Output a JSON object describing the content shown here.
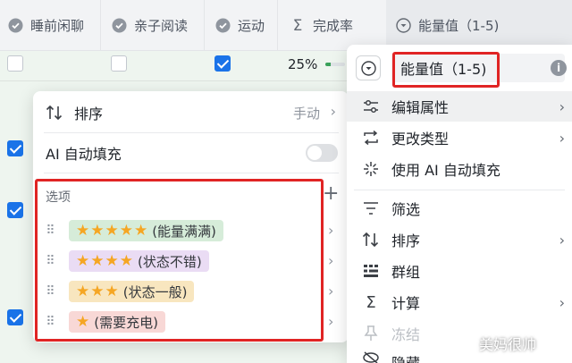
{
  "header": {
    "columns": [
      {
        "label": "睡前闲聊",
        "icon": "checkbox-field-icon"
      },
      {
        "label": "亲子阅读",
        "icon": "checkbox-field-icon"
      },
      {
        "label": "运动",
        "icon": "checkbox-field-icon"
      },
      {
        "label": "完成率",
        "icon": "sigma-formula-icon"
      },
      {
        "label": "能量值（1-5)",
        "icon": "single-select-field-icon"
      }
    ]
  },
  "rows": [
    {
      "col1": false,
      "col2": false,
      "col3": true,
      "progress_label": "25%",
      "progress": 0.25
    }
  ],
  "left_checks": [
    true,
    true,
    true
  ],
  "popup": {
    "sort_label": "排序",
    "sort_value": "手动",
    "ai_fill_label": "AI 自动填充",
    "ai_fill_on": false,
    "options_title": "选项",
    "add_symbol": "+",
    "options": [
      {
        "stars": "★★★★★",
        "text": "(能量满满)",
        "color": "#d6ecd9"
      },
      {
        "stars": "★★★★",
        "text": "(状态不错)",
        "color": "#eadcf4"
      },
      {
        "stars": "★★★",
        "text": "(状态一般)",
        "color": "#f8e6bf"
      },
      {
        "stars": "★",
        "text": "(需要充电)",
        "color": "#f8d8d6"
      }
    ]
  },
  "menu": {
    "field_name": "能量值（1-5)",
    "info_symbol": "i",
    "items": [
      {
        "label": "编辑属性",
        "icon": "sliders-icon",
        "chevron": true
      },
      {
        "label": "更改类型",
        "icon": "swap-icon",
        "chevron": true
      },
      {
        "label": "使用 AI 自动填充",
        "icon": "sparkle-icon",
        "chevron": false
      },
      {
        "label": "筛选",
        "icon": "filter-icon",
        "chevron": false
      },
      {
        "label": "排序",
        "icon": "sort-icon",
        "chevron": true
      },
      {
        "label": "群组",
        "icon": "group-icon",
        "chevron": false
      },
      {
        "label": "计算",
        "icon": "sigma-icon",
        "chevron": true
      },
      {
        "label": "冻结",
        "icon": "pin-icon",
        "chevron": false
      },
      {
        "label": "隐藏",
        "icon": "hide-icon",
        "chevron": false
      }
    ]
  },
  "watermark": "美妈很帅",
  "colors": {
    "accent": "#1a73e8",
    "highlight": "#e02424",
    "progress": "#3aa15a"
  }
}
